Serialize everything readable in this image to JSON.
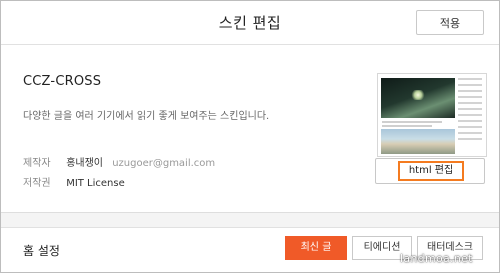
{
  "header": {
    "title": "스킨 편집",
    "apply_label": "적용"
  },
  "skin": {
    "name": "CCZ-CROSS",
    "description": "다양한 글을 여러 기기에서 읽기 좋게 보여주는 스킨입니다.",
    "author_label": "제작자",
    "author_name": "홍내쟁이",
    "author_email": "uzugoer@gmail.com",
    "license_label": "저작권",
    "license_value": "MIT License",
    "html_edit_label": "html 편집"
  },
  "home_settings": {
    "title": "홈 설정",
    "tabs": [
      {
        "label": "최신 글",
        "active": true
      },
      {
        "label": "티에디션",
        "active": false
      },
      {
        "label": "태터데스크",
        "active": false
      }
    ]
  },
  "watermark": "landmoa.net",
  "colors": {
    "accent": "#f05a28",
    "highlight_border": "#f47b20"
  }
}
